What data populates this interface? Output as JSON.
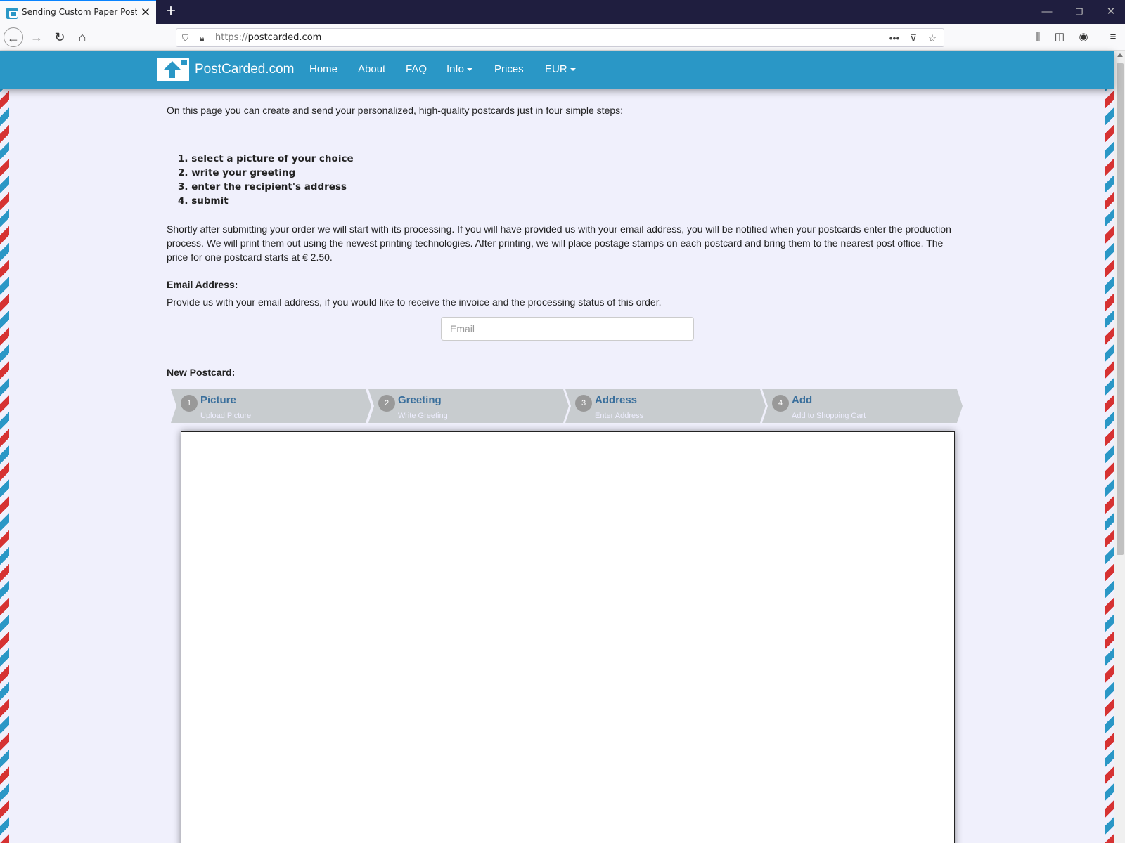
{
  "browser": {
    "tab_title": "Sending Custom Paper Postcar",
    "url_scheme": "https://",
    "url_host": "postcarded.com"
  },
  "site": {
    "brand": "PostCarded.com",
    "nav": {
      "home": "Home",
      "about": "About",
      "faq": "FAQ",
      "info": "Info",
      "prices": "Prices",
      "currency": "EUR"
    }
  },
  "content": {
    "intro": "On this page you can create and send your personalized, high-quality postcards just in four simple steps:",
    "steps": [
      "1. select a picture of your choice",
      "2. write your greeting",
      "3. enter the recipient's address",
      "4. submit"
    ],
    "processing": "Shortly after submitting your order we will start with its processing. If you will have provided us with your email address, you will be notified when your postcards enter the production process. We will print them out using the newest printing technologies. After printing, we will place postage stamps on each postcard and bring them to the nearest post office. The price for one postcard starts at € 2.50.",
    "email_heading": "Email Address:",
    "email_desc": "Provide us with your email address, if you would like to receive the invoice and the processing status of this order.",
    "email_placeholder": "Email",
    "new_postcard": "New Postcard:"
  },
  "wizard": [
    {
      "num": "1",
      "title": "Picture",
      "sub": "Upload Picture"
    },
    {
      "num": "2",
      "title": "Greeting",
      "sub": "Write Greeting"
    },
    {
      "num": "3",
      "title": "Address",
      "sub": "Enter Address"
    },
    {
      "num": "4",
      "title": "Add",
      "sub": "Add to Shopping Cart"
    }
  ],
  "colors": {
    "brand_blue": "#2a97c6",
    "page_bg": "#f0f0fc",
    "airmail_red": "#d63232",
    "wizard_bg": "#c8cccf"
  },
  "icons": {
    "back": "arrow-left-icon",
    "forward": "arrow-right-icon",
    "reload": "reload-icon",
    "home": "home-icon",
    "menu": "hamburger-icon"
  }
}
